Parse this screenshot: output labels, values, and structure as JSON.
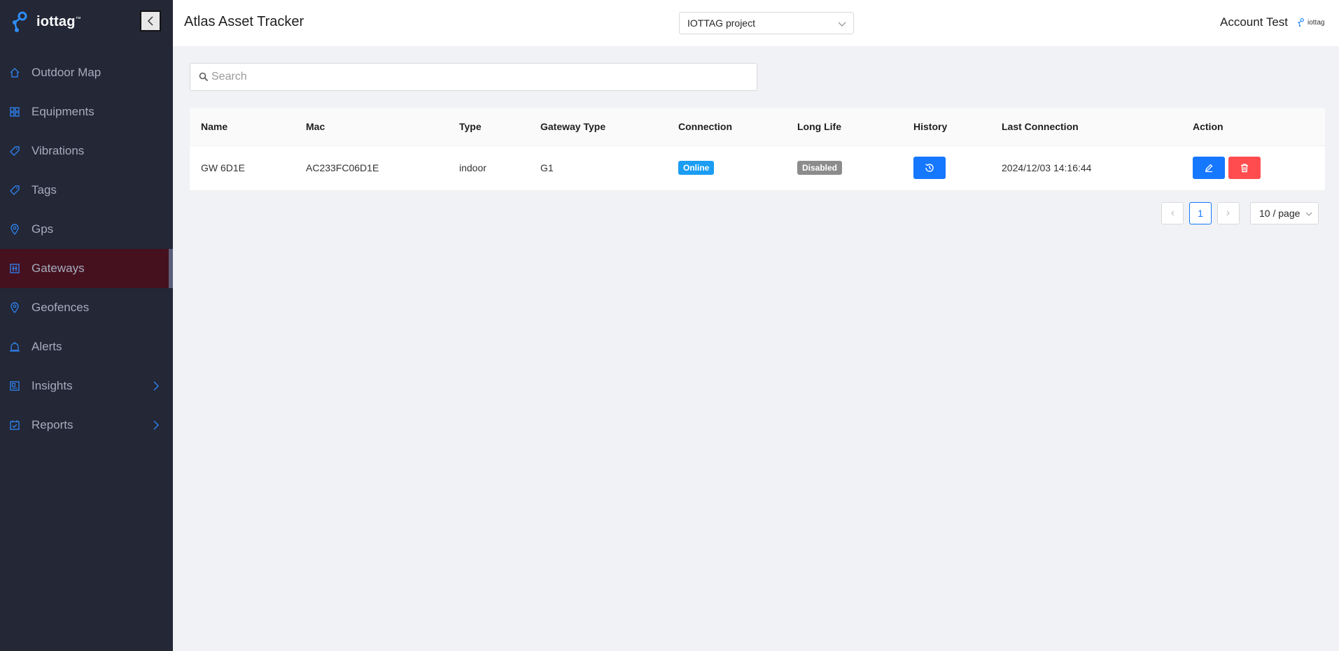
{
  "brand": {
    "name": "iottag",
    "mark": "™"
  },
  "header": {
    "title": "Atlas Asset Tracker",
    "project": "IOTTAG project",
    "account": "Account Test",
    "mini_logo": "iottag"
  },
  "sidebar": {
    "items": [
      {
        "label": "Outdoor Map",
        "icon": "home-icon"
      },
      {
        "label": "Equipments",
        "icon": "grid-icon"
      },
      {
        "label": "Vibrations",
        "icon": "tag-icon"
      },
      {
        "label": "Tags",
        "icon": "tag-icon"
      },
      {
        "label": "Gps",
        "icon": "location-pin-icon"
      },
      {
        "label": "Gateways",
        "icon": "gateway-icon",
        "active": true
      },
      {
        "label": "Geofences",
        "icon": "location-pin-icon"
      },
      {
        "label": "Alerts",
        "icon": "alarm-icon"
      },
      {
        "label": "Insights",
        "icon": "dashboard-icon",
        "expandable": true
      },
      {
        "label": "Reports",
        "icon": "calendar-check-icon",
        "expandable": true
      }
    ]
  },
  "search": {
    "placeholder": "Search",
    "value": ""
  },
  "table": {
    "columns": [
      "Name",
      "Mac",
      "Type",
      "Gateway Type",
      "Connection",
      "Long Life",
      "History",
      "Last Connection",
      "Action"
    ],
    "rows": [
      {
        "name": "GW 6D1E",
        "mac": "AC233FC06D1E",
        "type": "indoor",
        "gateway_type": "G1",
        "connection": "Online",
        "long_life": "Disabled",
        "last_connection": "2024/12/03 14:16:44"
      }
    ]
  },
  "pagination": {
    "current": "1",
    "page_size": "10 / page"
  },
  "colors": {
    "sidebar_bg": "#232736",
    "active_bg": "#45111f",
    "primary": "#1677ff",
    "danger": "#ff4d4f",
    "online": "#1a9df2",
    "disabled": "#8c8c8c"
  }
}
